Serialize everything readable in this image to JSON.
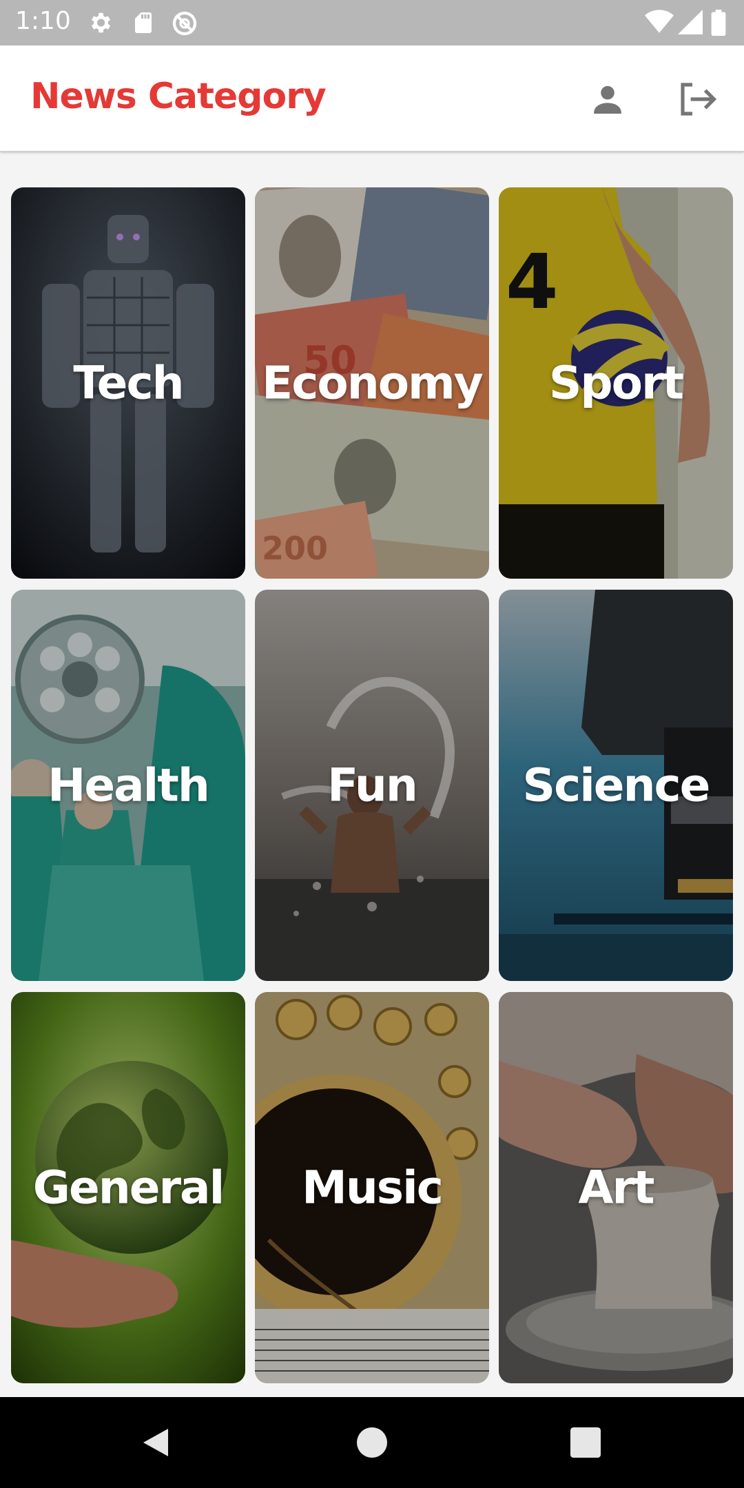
{
  "status_bar": {
    "time": "1:10",
    "left_icons": [
      "gear-icon",
      "sd-card-icon",
      "sync-blocked-icon"
    ],
    "right_icons": [
      "wifi-icon",
      "cell-signal-icon",
      "battery-icon"
    ]
  },
  "app_bar": {
    "title": "News Category",
    "title_color": "#e53935",
    "actions": [
      "person-icon",
      "logout-icon"
    ]
  },
  "categories": [
    {
      "label": "Tech"
    },
    {
      "label": "Economy"
    },
    {
      "label": "Sport"
    },
    {
      "label": "Health"
    },
    {
      "label": "Fun"
    },
    {
      "label": "Science"
    },
    {
      "label": "General"
    },
    {
      "label": "Music"
    },
    {
      "label": "Art"
    }
  ],
  "nav_bar": {
    "buttons": [
      "back-icon",
      "home-icon",
      "recents-icon"
    ]
  }
}
